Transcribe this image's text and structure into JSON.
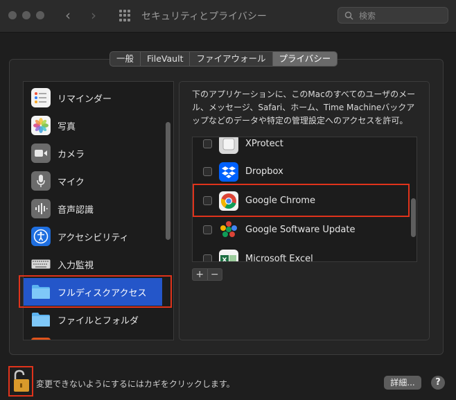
{
  "window": {
    "title": "セキュリティとプライバシー"
  },
  "search": {
    "placeholder": "検索"
  },
  "tabs": [
    {
      "label": "一般",
      "active": false
    },
    {
      "label": "FileVault",
      "active": false
    },
    {
      "label": "ファイアウォール",
      "active": false
    },
    {
      "label": "プライバシー",
      "active": true
    }
  ],
  "sidebar": {
    "items": [
      {
        "label": "リマインダー",
        "icon": "reminders-icon"
      },
      {
        "label": "写真",
        "icon": "photos-icon"
      },
      {
        "label": "カメラ",
        "icon": "camera-icon"
      },
      {
        "label": "マイク",
        "icon": "microphone-icon"
      },
      {
        "label": "音声認識",
        "icon": "speech-recognition-icon"
      },
      {
        "label": "アクセシビリティ",
        "icon": "accessibility-icon"
      },
      {
        "label": "入力監視",
        "icon": "keyboard-icon"
      },
      {
        "label": "フルディスクアクセス",
        "icon": "folder-icon",
        "selected": true
      },
      {
        "label": "ファイルとフォルダ",
        "icon": "folder-icon"
      }
    ]
  },
  "main": {
    "description": "下のアプリケーションに、このMacのすべてのユーザのメール、メッセージ、Safari、ホーム、Time Machineバックアップなどのデータや特定の管理設定へのアクセスを許可。",
    "apps": [
      {
        "name": "XProtect",
        "checked": false,
        "icon": "xprotect-icon"
      },
      {
        "name": "Dropbox",
        "checked": false,
        "icon": "dropbox-icon"
      },
      {
        "name": "Google Chrome",
        "checked": false,
        "icon": "chrome-icon",
        "highlighted": true
      },
      {
        "name": "Google Software Update",
        "checked": false,
        "icon": "google-software-update-icon"
      },
      {
        "name": "Microsoft Excel",
        "checked": false,
        "icon": "excel-icon"
      }
    ],
    "add_label": "+",
    "remove_label": "−"
  },
  "footer": {
    "lock_text": "変更できないようにするにはカギをクリックします。",
    "detail_label": "詳細...",
    "help_label": "?"
  },
  "colors": {
    "selection": "#2456c9",
    "highlight_border": "#e0331b",
    "window_bg": "#1e1e1e"
  }
}
